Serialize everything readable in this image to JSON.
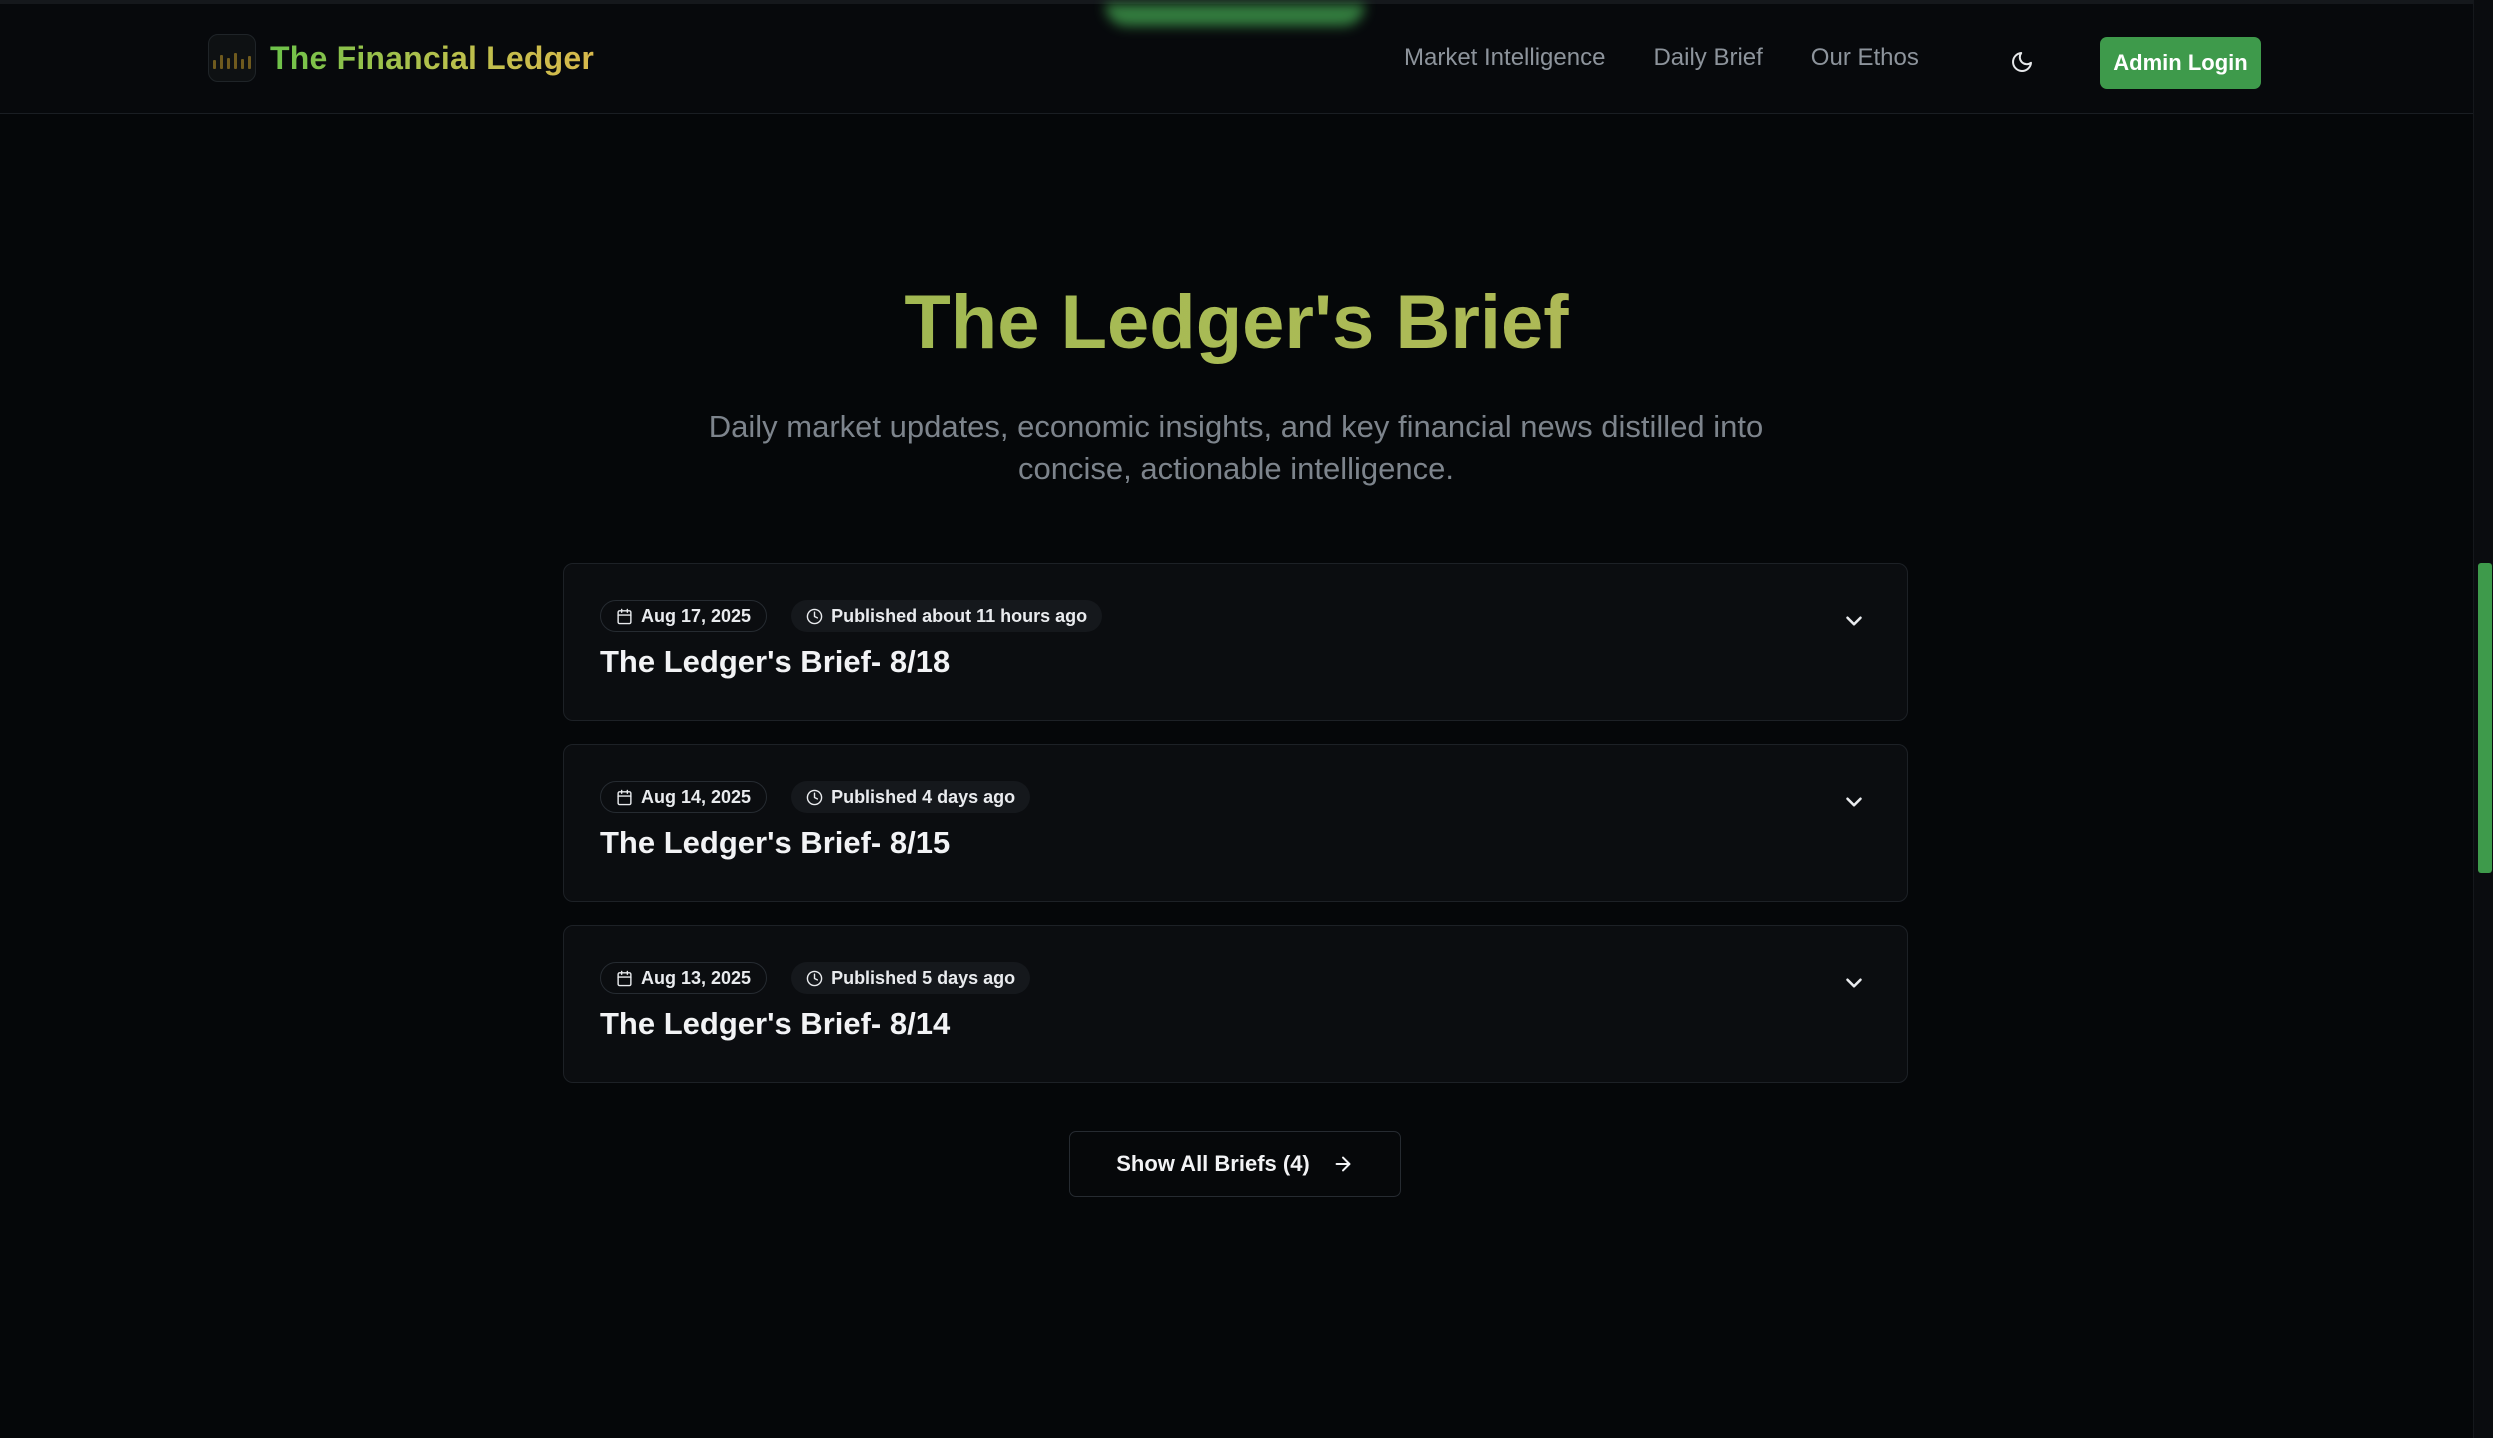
{
  "header": {
    "brand_name": "The Financial Ledger",
    "nav": [
      {
        "label": "Market Intelligence"
      },
      {
        "label": "Daily Brief"
      },
      {
        "label": "Our Ethos"
      }
    ],
    "theme_icon": "moon-icon",
    "admin_label": "Admin Login"
  },
  "hero": {
    "title": "The Ledger's Brief",
    "subtitle": "Daily market updates, economic insights, and key financial news distilled into concise, actionable intelligence."
  },
  "briefs": [
    {
      "date": "Aug 17, 2025",
      "published": "Published about 11 hours ago",
      "title": "The Ledger's Brief- 8/18"
    },
    {
      "date": "Aug 14, 2025",
      "published": "Published 4 days ago",
      "title": "The Ledger's Brief- 8/15"
    },
    {
      "date": "Aug 13, 2025",
      "published": "Published 5 days ago",
      "title": "The Ledger's Brief- 8/14"
    }
  ],
  "show_all_label": "Show All Briefs (4)",
  "colors": {
    "accent": "#3e9a4b",
    "background": "#050709",
    "card": "#0b0d10"
  }
}
